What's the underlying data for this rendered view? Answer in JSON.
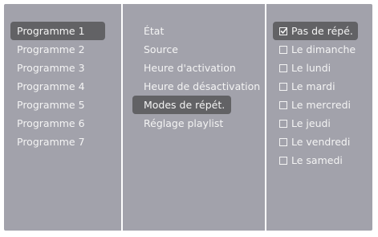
{
  "programs": [
    {
      "label": "Programme 1",
      "selected": true
    },
    {
      "label": "Programme 2",
      "selected": false
    },
    {
      "label": "Programme 3",
      "selected": false
    },
    {
      "label": "Programme 4",
      "selected": false
    },
    {
      "label": "Programme 5",
      "selected": false
    },
    {
      "label": "Programme 6",
      "selected": false
    },
    {
      "label": "Programme 7",
      "selected": false
    }
  ],
  "settings": [
    {
      "label": "État",
      "selected": false
    },
    {
      "label": "Source",
      "selected": false
    },
    {
      "label": "Heure d'activation",
      "selected": false
    },
    {
      "label": "Heure de désactivation",
      "selected": false
    },
    {
      "label": "Modes de répét.",
      "selected": true
    },
    {
      "label": "Réglage playlist",
      "selected": false
    }
  ],
  "repeat_options": [
    {
      "label": "Pas de répé.",
      "checked": true,
      "selected": true
    },
    {
      "label": "Le dimanche",
      "checked": false,
      "selected": false
    },
    {
      "label": "Le lundi",
      "checked": false,
      "selected": false
    },
    {
      "label": "Le mardi",
      "checked": false,
      "selected": false
    },
    {
      "label": "Le mercredi",
      "checked": false,
      "selected": false
    },
    {
      "label": "Le jeudi",
      "checked": false,
      "selected": false
    },
    {
      "label": "Le vendredi",
      "checked": false,
      "selected": false
    },
    {
      "label": "Le samedi",
      "checked": false,
      "selected": false
    }
  ],
  "colors": {
    "panel": "#a2a2ab",
    "highlight": "#626265",
    "text": "#f4f4f4",
    "divider": "#ffffff"
  }
}
